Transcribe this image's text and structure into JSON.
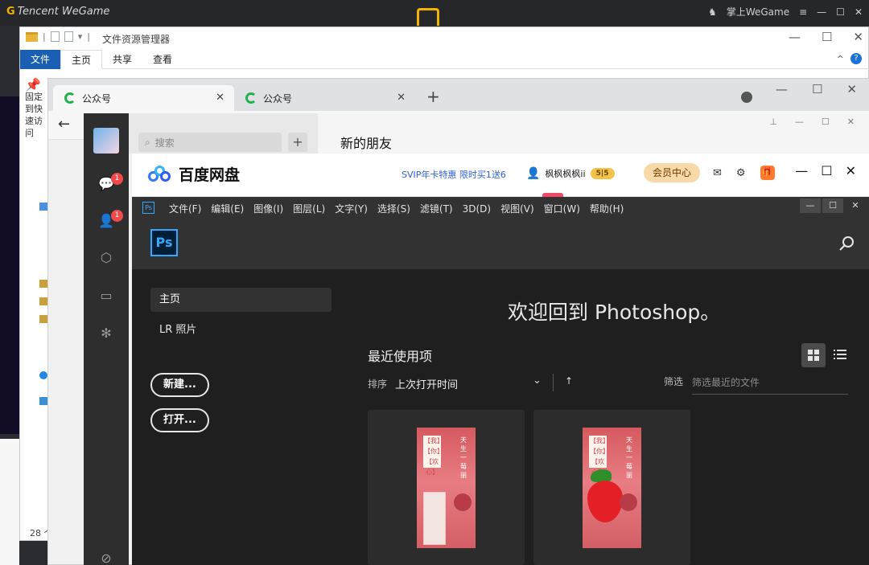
{
  "wegame": {
    "logo": "Tencent WeGame",
    "mobile_label": "掌上WeGame"
  },
  "explorer": {
    "title": "文件资源管理器",
    "ribbon_tabs": [
      "文件",
      "主页",
      "共享",
      "查看"
    ],
    "pin_label": "固定到快速访问",
    "status": "28 个"
  },
  "wechat_browser": {
    "tabs": [
      {
        "label": "公众号"
      },
      {
        "label": "公众号"
      }
    ]
  },
  "wechat_client": {
    "search_placeholder": "搜索",
    "chat_title": "新的朋友",
    "badges": [
      "1",
      "1"
    ]
  },
  "baidu": {
    "brand": "百度网盘",
    "promo": "SVIP年卡特惠 限时买1送6",
    "username": "枫枫枫枫ii",
    "coin_badge": "5",
    "vip_button": "会员中心"
  },
  "photoshop": {
    "mini_logo": "Ps",
    "menu": [
      "文件(F)",
      "编辑(E)",
      "图像(I)",
      "图层(L)",
      "文字(Y)",
      "选择(S)",
      "滤镜(T)",
      "3D(D)",
      "视图(V)",
      "窗口(W)",
      "帮助(H)"
    ],
    "logo": "Ps",
    "nav": {
      "home": "主页",
      "lr": "LR 照片"
    },
    "new_button": "新建...",
    "open_button": "打开...",
    "welcome": "欢迎回到 Photoshop。",
    "recent_title": "最近使用项",
    "sort_label": "排序",
    "sort_value": "上次打开时间",
    "filter_label": "筛选",
    "filter_placeholder": "筛选最近的文件",
    "thumb_text": {
      "left": "【我】【你】【欢心】",
      "right": "天生一莓丽"
    }
  },
  "colors": {
    "ps_accent": "#31a8ff",
    "wegame_gold": "#f0b400",
    "baidu_blue": "#2f7bf6",
    "wechat_green": "#23b14d",
    "badge_red": "#f04a4a"
  }
}
